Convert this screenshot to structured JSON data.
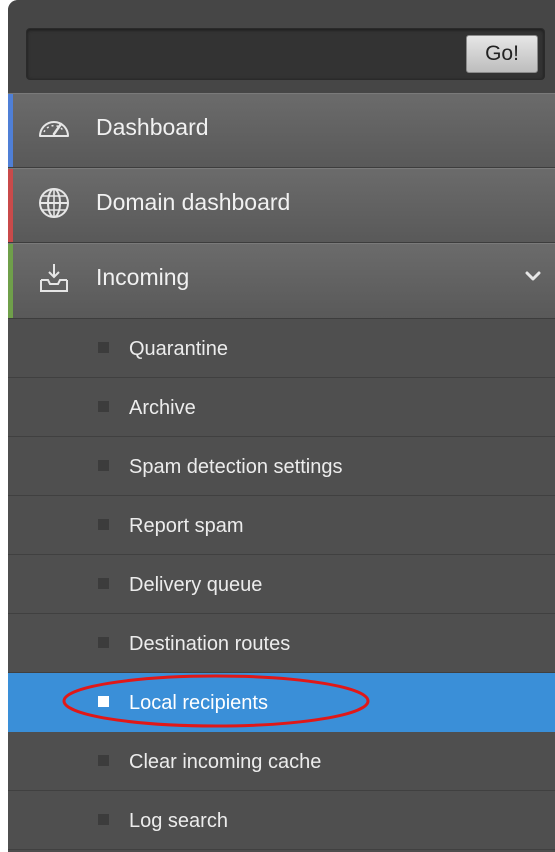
{
  "search": {
    "value": "",
    "button_label": "Go!"
  },
  "nav": [
    {
      "label": "Dashboard",
      "icon": "speedometer-icon",
      "accent": "#4f7fd6"
    },
    {
      "label": "Domain dashboard",
      "icon": "globe-icon",
      "accent": "#c94a4a"
    },
    {
      "label": "Incoming",
      "icon": "inbox-download-icon",
      "accent": "#6f9f4a",
      "expanded": true
    }
  ],
  "incoming_items": [
    {
      "label": "Quarantine"
    },
    {
      "label": "Archive"
    },
    {
      "label": "Spam detection settings"
    },
    {
      "label": "Report spam"
    },
    {
      "label": "Delivery queue"
    },
    {
      "label": "Destination routes"
    },
    {
      "label": "Local recipients",
      "active": true
    },
    {
      "label": "Clear incoming cache"
    },
    {
      "label": "Log search"
    }
  ],
  "colors": {
    "active_item": "#3a8fd8",
    "annotation": "#e01818"
  }
}
